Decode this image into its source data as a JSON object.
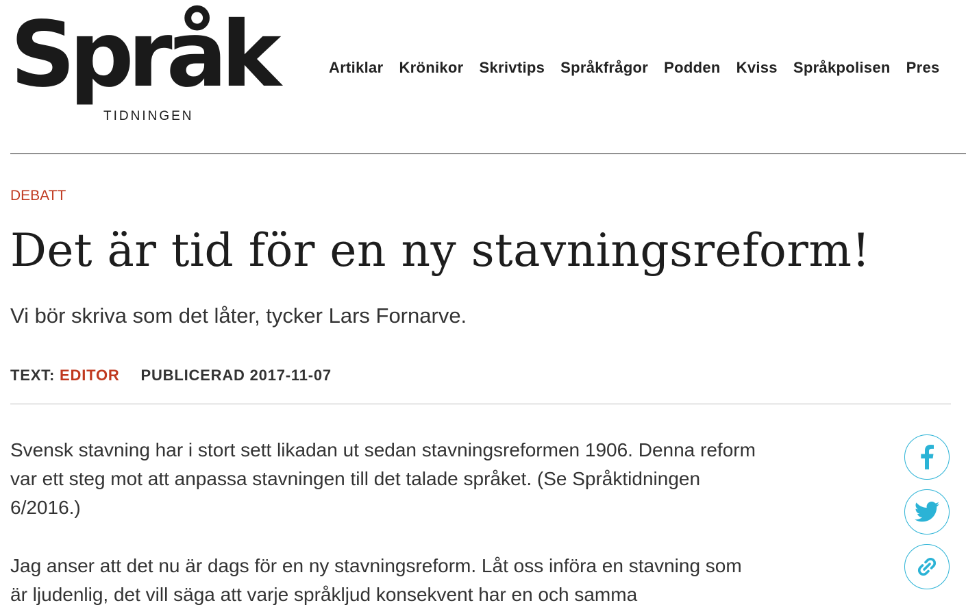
{
  "logo": {
    "wordmark": "Språk",
    "subtitle": "TIDNINGEN"
  },
  "nav": {
    "items": [
      "Artiklar",
      "Krönikor",
      "Skrivtips",
      "Språkfrågor",
      "Podden",
      "Kviss",
      "Språkpolisen",
      "Pres"
    ]
  },
  "article": {
    "category": "DEBATT",
    "title": "Det är tid för en ny stavningsreform!",
    "lead": "Vi bör skriva som det låter, tycker Lars Fornarve.",
    "byline": {
      "text_label": "TEXT:",
      "author": "EDITOR",
      "published": "PUBLICERAD 2017-11-07"
    },
    "paragraphs": [
      "Svensk stavning har i stort sett likadan ut sedan stavningsreformen 1906. Denna reform var ett steg mot att anpassa stavningen till det talade språket. (Se Språktidningen 6/2016.)",
      "Jag anser att det nu är dags för en ny stavningsreform. Låt oss införa en stavning som är ljudenlig, det vill säga att varje språkljud konsekvent har en och samma"
    ]
  },
  "share": {
    "buttons": [
      "facebook-icon",
      "twitter-icon",
      "link-icon"
    ],
    "color": "#2bb3d6"
  },
  "colors": {
    "accent": "#c0391f",
    "text": "#1d1d1d",
    "share": "#2bb3d6"
  }
}
